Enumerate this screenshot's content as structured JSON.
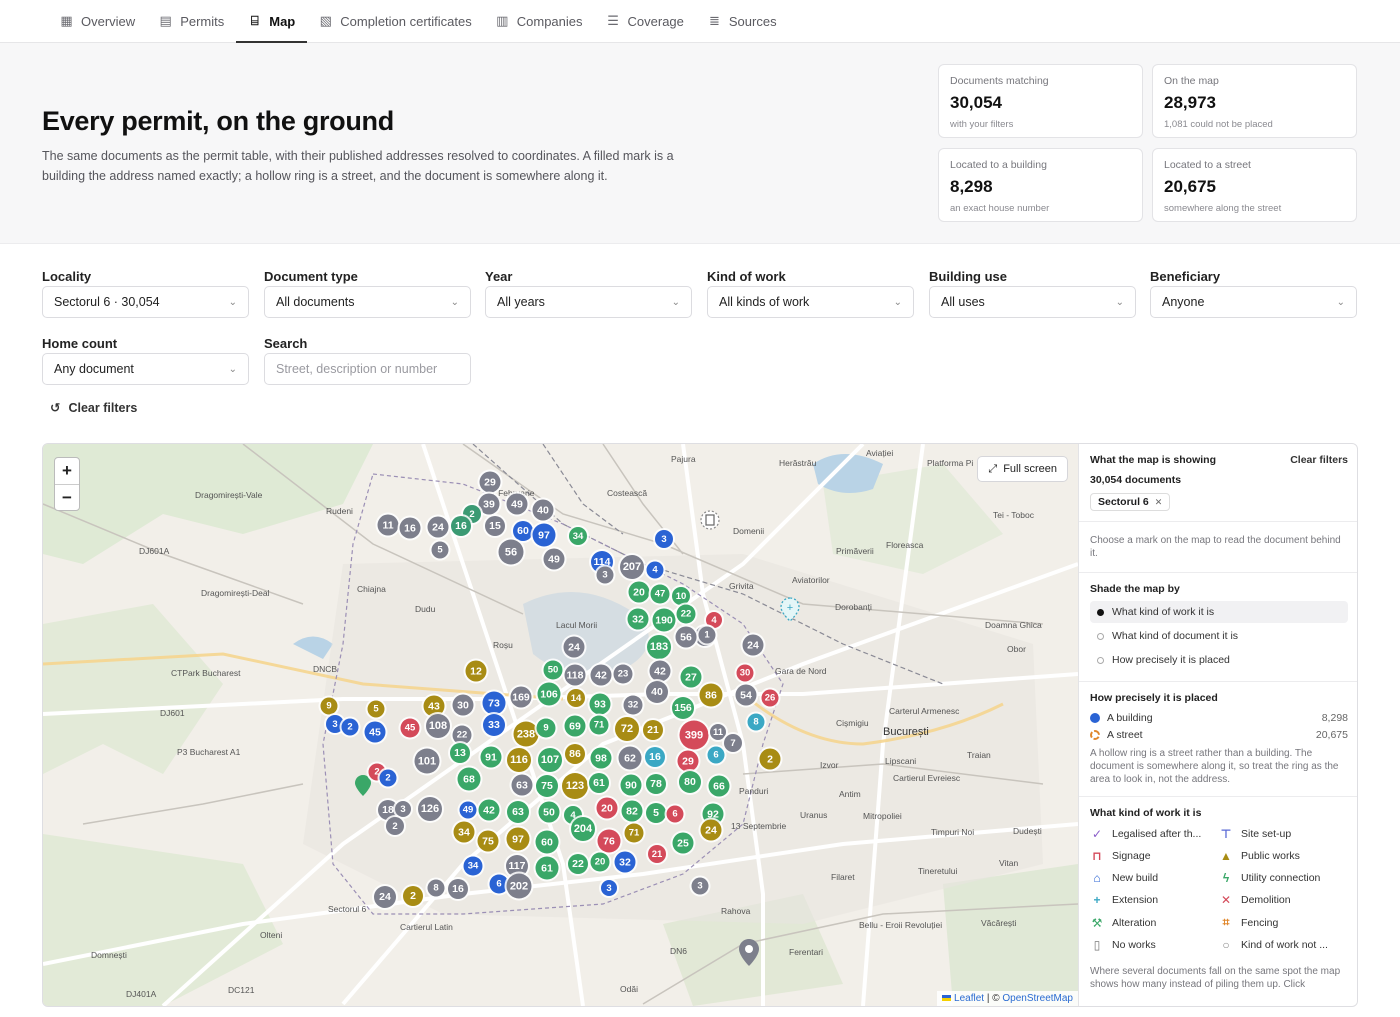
{
  "nav": [
    {
      "label": "Overview",
      "icon": "grid-icon",
      "glyph": "▦",
      "active": false
    },
    {
      "label": "Permits",
      "icon": "document-icon",
      "glyph": "▤",
      "active": false
    },
    {
      "label": "Map",
      "icon": "map-icon",
      "glyph": "⌸",
      "active": true
    },
    {
      "label": "Completion certificates",
      "icon": "certificate-icon",
      "glyph": "▧",
      "active": false
    },
    {
      "label": "Companies",
      "icon": "building-icon",
      "glyph": "▥",
      "active": false
    },
    {
      "label": "Coverage",
      "icon": "checklist-icon",
      "glyph": "☰",
      "active": false
    },
    {
      "label": "Sources",
      "icon": "database-icon",
      "glyph": "≣",
      "active": false
    }
  ],
  "hero": {
    "title": "Every permit, on the ground",
    "subtitle": "The same documents as the permit table, with their published addresses resolved to coordinates. A filled mark is a building the address named exactly; a hollow ring is a street, and the document is somewhere along it."
  },
  "stats": [
    {
      "label": "Documents matching",
      "value": "30,054",
      "note": "with your filters"
    },
    {
      "label": "On the map",
      "value": "28,973",
      "note": "1,081 could not be placed"
    },
    {
      "label": "Located to a building",
      "value": "8,298",
      "note": "an exact house number"
    },
    {
      "label": "Located to a street",
      "value": "20,675",
      "note": "somewhere along the street"
    }
  ],
  "filters": {
    "locality": {
      "label": "Locality",
      "value": "Sectorul 6 · 30,054"
    },
    "doc_type": {
      "label": "Document type",
      "value": "All documents"
    },
    "year": {
      "label": "Year",
      "value": "All years"
    },
    "kind": {
      "label": "Kind of work",
      "value": "All kinds of work"
    },
    "use": {
      "label": "Building use",
      "value": "All uses"
    },
    "beneficiary": {
      "label": "Beneficiary",
      "value": "Anyone"
    },
    "home_count": {
      "label": "Home count",
      "value": "Any document"
    },
    "search": {
      "label": "Search",
      "placeholder": "Street, description or number"
    },
    "clear": "Clear filters"
  },
  "map": {
    "zoom_in": "+",
    "zoom_out": "−",
    "fullscreen": "Full screen",
    "attribution_leaflet": "Leaflet",
    "attribution_sep": " | © ",
    "attribution_osm": "OpenStreetMap",
    "places": [
      {
        "name": "Pajura",
        "big": false
      },
      {
        "name": "Herăstrău",
        "big": false
      },
      {
        "name": "Aviației",
        "big": false
      },
      {
        "name": "Platforma Pi",
        "big": false
      },
      {
        "name": "Dragomirești-Vale",
        "big": false
      },
      {
        "name": "Rudeni",
        "big": false
      },
      {
        "name": "1 Februarie",
        "big": false
      },
      {
        "name": "Costească",
        "big": false
      },
      {
        "name": "Domenii",
        "big": false
      },
      {
        "name": "Tei - Toboc",
        "big": false
      },
      {
        "name": "Primăverii",
        "big": false
      },
      {
        "name": "Floreasca",
        "big": false
      },
      {
        "name": "Grivita",
        "big": false
      },
      {
        "name": "Aviatorilor",
        "big": false
      },
      {
        "name": "Dragomirești-Deal",
        "big": false
      },
      {
        "name": "Chiajna",
        "big": false
      },
      {
        "name": "Dudu",
        "big": false
      },
      {
        "name": "Dorobanți",
        "big": false
      },
      {
        "name": "Doamna Ghica",
        "big": false
      },
      {
        "name": "Roșu",
        "big": false
      },
      {
        "name": "Lacul Morii",
        "big": false
      },
      {
        "name": "Obor",
        "big": false
      },
      {
        "name": "Gara de Nord",
        "big": false
      },
      {
        "name": "Carterul Armenesc",
        "big": false
      },
      {
        "name": "Cișmigiu",
        "big": false
      },
      {
        "name": "București",
        "big": true
      },
      {
        "name": "Traian",
        "big": false
      },
      {
        "name": "Lipscani",
        "big": false
      },
      {
        "name": "Izvor",
        "big": false
      },
      {
        "name": "Cartierul Evreiesc",
        "big": false
      },
      {
        "name": "Antim",
        "big": false
      },
      {
        "name": "Panduri",
        "big": false
      },
      {
        "name": "Uranus",
        "big": false
      },
      {
        "name": "Mitropoliei",
        "big": false
      },
      {
        "name": "13 Septembrie",
        "big": false
      },
      {
        "name": "Timpuri Noi",
        "big": false
      },
      {
        "name": "Dudești",
        "big": false
      },
      {
        "name": "Vitan",
        "big": false
      },
      {
        "name": "Tineretului",
        "big": false
      },
      {
        "name": "Filaret",
        "big": false
      },
      {
        "name": "Rahova",
        "big": false
      },
      {
        "name": "Bellu - Eroii Revoluției",
        "big": false
      },
      {
        "name": "Văcărești",
        "big": false
      },
      {
        "name": "Ferentari",
        "big": false
      },
      {
        "name": "Cartierul Latin",
        "big": false
      },
      {
        "name": "Olteni",
        "big": false
      },
      {
        "name": "Domnești",
        "big": false
      },
      {
        "name": "Odăi",
        "big": false
      },
      {
        "name": "DJ601A",
        "big": false
      },
      {
        "name": "DJ601",
        "big": false
      },
      {
        "name": "DNCB",
        "big": false
      },
      {
        "name": "DN6",
        "big": false
      },
      {
        "name": "DC121",
        "big": false
      },
      {
        "name": "DJ401A",
        "big": false
      },
      {
        "name": "CTPark Bucharest",
        "big": false
      },
      {
        "name": "P3 Bucharest A1",
        "big": false
      },
      {
        "name": "Sectorul 6",
        "big": false
      }
    ],
    "clusters": [
      {
        "n": "29",
        "c": "#7d7f8c"
      },
      {
        "n": "39",
        "c": "#7d7f8c"
      },
      {
        "n": "49",
        "c": "#7d7f8c"
      },
      {
        "n": "40",
        "c": "#7d7f8c"
      },
      {
        "n": "2",
        "c": "#3b9a73"
      },
      {
        "n": "60",
        "c": "#2a63d4"
      },
      {
        "n": "97",
        "c": "#2a63d4"
      },
      {
        "n": "11",
        "c": "#7d7f8c"
      },
      {
        "n": "16",
        "c": "#7d7f8c"
      },
      {
        "n": "24",
        "c": "#7d7f8c"
      },
      {
        "n": "16",
        "c": "#3b9a73"
      },
      {
        "n": "15",
        "c": "#7d7f8c"
      },
      {
        "n": "5",
        "c": "#7d7f8c"
      },
      {
        "n": "56",
        "c": "#7d7f8c"
      },
      {
        "n": "49",
        "c": "#7d7f8c"
      },
      {
        "n": "34",
        "c": "#3aa768"
      },
      {
        "n": "3",
        "c": "#2a63d4"
      },
      {
        "n": "114",
        "c": "#2a63d4"
      },
      {
        "n": "207",
        "c": "#7d7f8c"
      },
      {
        "n": "3",
        "c": "#7d7f8c"
      },
      {
        "n": "4",
        "c": "#2a63d4"
      },
      {
        "n": "20",
        "c": "#3aa768"
      },
      {
        "n": "47",
        "c": "#3aa768"
      },
      {
        "n": "10",
        "c": "#3aa768"
      },
      {
        "n": "32",
        "c": "#3aa768"
      },
      {
        "n": "190",
        "c": "#3aa768"
      },
      {
        "n": "22",
        "c": "#3aa768"
      },
      {
        "n": "4",
        "c": "#d44a5a"
      },
      {
        "n": "24",
        "c": "#7d7f8c"
      },
      {
        "n": "183",
        "c": "#3aa768"
      },
      {
        "n": "56",
        "c": "#7d7f8c"
      },
      {
        "n": "1",
        "c": "#7d7f8c"
      },
      {
        "n": "24",
        "c": "#7d7f8c"
      },
      {
        "n": "24",
        "c": "#7d7f8c"
      },
      {
        "n": "50",
        "c": "#3aa768"
      },
      {
        "n": "118",
        "c": "#7d7f8c"
      },
      {
        "n": "42",
        "c": "#7d7f8c"
      },
      {
        "n": "23",
        "c": "#7d7f8c"
      },
      {
        "n": "42",
        "c": "#7d7f8c"
      },
      {
        "n": "12",
        "c": "#a88c14"
      },
      {
        "n": "27",
        "c": "#3aa768"
      },
      {
        "n": "30",
        "c": "#d44a5a"
      },
      {
        "n": "40",
        "c": "#7d7f8c"
      },
      {
        "n": "169",
        "c": "#7d7f8c"
      },
      {
        "n": "106",
        "c": "#3aa768"
      },
      {
        "n": "14",
        "c": "#a88c14"
      },
      {
        "n": "86",
        "c": "#a88c14"
      },
      {
        "n": "54",
        "c": "#7d7f8c"
      },
      {
        "n": "26",
        "c": "#d44a5a"
      },
      {
        "n": "9",
        "c": "#a88c14"
      },
      {
        "n": "5",
        "c": "#a88c14"
      },
      {
        "n": "43",
        "c": "#a88c14"
      },
      {
        "n": "30",
        "c": "#7d7f8c"
      },
      {
        "n": "73",
        "c": "#2a63d4"
      },
      {
        "n": "93",
        "c": "#3aa768"
      },
      {
        "n": "32",
        "c": "#7d7f8c"
      },
      {
        "n": "156",
        "c": "#3aa768"
      },
      {
        "n": "8",
        "c": "#3ba8c4"
      },
      {
        "n": "3",
        "c": "#2a63d4"
      },
      {
        "n": "2",
        "c": "#2a63d4"
      },
      {
        "n": "45",
        "c": "#2a63d4"
      },
      {
        "n": "45",
        "c": "#d44a5a"
      },
      {
        "n": "108",
        "c": "#7d7f8c"
      },
      {
        "n": "22",
        "c": "#7d7f8c"
      },
      {
        "n": "33",
        "c": "#2a63d4"
      },
      {
        "n": "238",
        "c": "#a88c14"
      },
      {
        "n": "9",
        "c": "#3aa768"
      },
      {
        "n": "69",
        "c": "#3aa768"
      },
      {
        "n": "71",
        "c": "#3aa768"
      },
      {
        "n": "72",
        "c": "#a88c14"
      },
      {
        "n": "21",
        "c": "#a88c14"
      },
      {
        "n": "399",
        "c": "#d44a5a"
      },
      {
        "n": "11",
        "c": "#7d7f8c"
      },
      {
        "n": "7",
        "c": "#7d7f8c"
      },
      {
        "n": "101",
        "c": "#7d7f8c"
      },
      {
        "n": "13",
        "c": "#3aa768"
      },
      {
        "n": "91",
        "c": "#3aa768"
      },
      {
        "n": "116",
        "c": "#a88c14"
      },
      {
        "n": "107",
        "c": "#3aa768"
      },
      {
        "n": "86",
        "c": "#a88c14"
      },
      {
        "n": "98",
        "c": "#3aa768"
      },
      {
        "n": "62",
        "c": "#7d7f8c"
      },
      {
        "n": "16",
        "c": "#3ba8c4"
      },
      {
        "n": "29",
        "c": "#d44a5a"
      },
      {
        "n": "6",
        "c": "#3ba8c4"
      },
      {
        "n": "2",
        "c": "#a88c14"
      },
      {
        "n": "2",
        "c": "#d44a5a"
      },
      {
        "n": "2",
        "c": "#2a63d4"
      },
      {
        "n": "68",
        "c": "#3aa768"
      },
      {
        "n": "63",
        "c": "#7d7f8c"
      },
      {
        "n": "75",
        "c": "#3aa768"
      },
      {
        "n": "123",
        "c": "#a88c14"
      },
      {
        "n": "61",
        "c": "#3aa768"
      },
      {
        "n": "90",
        "c": "#3aa768"
      },
      {
        "n": "78",
        "c": "#3aa768"
      },
      {
        "n": "80",
        "c": "#3aa768"
      },
      {
        "n": "66",
        "c": "#3aa768"
      },
      {
        "n": "18",
        "c": "#7d7f8c"
      },
      {
        "n": "3",
        "c": "#7d7f8c"
      },
      {
        "n": "126",
        "c": "#7d7f8c"
      },
      {
        "n": "2",
        "c": "#7d7f8c"
      },
      {
        "n": "49",
        "c": "#2a63d4"
      },
      {
        "n": "42",
        "c": "#3aa768"
      },
      {
        "n": "63",
        "c": "#3aa768"
      },
      {
        "n": "50",
        "c": "#3aa768"
      },
      {
        "n": "4",
        "c": "#3aa768"
      },
      {
        "n": "20",
        "c": "#d44a5a"
      },
      {
        "n": "82",
        "c": "#3aa768"
      },
      {
        "n": "5",
        "c": "#3aa768"
      },
      {
        "n": "6",
        "c": "#d44a5a"
      },
      {
        "n": "92",
        "c": "#3aa768"
      },
      {
        "n": "34",
        "c": "#a88c14"
      },
      {
        "n": "75",
        "c": "#a88c14"
      },
      {
        "n": "97",
        "c": "#a88c14"
      },
      {
        "n": "60",
        "c": "#3aa768"
      },
      {
        "n": "204",
        "c": "#3aa768"
      },
      {
        "n": "76",
        "c": "#d44a5a"
      },
      {
        "n": "71",
        "c": "#a88c14"
      },
      {
        "n": "24",
        "c": "#a88c14"
      },
      {
        "n": "25",
        "c": "#3aa768"
      },
      {
        "n": "34",
        "c": "#2a63d4"
      },
      {
        "n": "117",
        "c": "#7d7f8c"
      },
      {
        "n": "61",
        "c": "#3aa768"
      },
      {
        "n": "22",
        "c": "#3aa768"
      },
      {
        "n": "20",
        "c": "#3aa768"
      },
      {
        "n": "32",
        "c": "#2a63d4"
      },
      {
        "n": "21",
        "c": "#d44a5a"
      },
      {
        "n": "24",
        "c": "#7d7f8c"
      },
      {
        "n": "2",
        "c": "#a88c14"
      },
      {
        "n": "8",
        "c": "#7d7f8c"
      },
      {
        "n": "16",
        "c": "#7d7f8c"
      },
      {
        "n": "6",
        "c": "#2a63d4"
      },
      {
        "n": "202",
        "c": "#7d7f8c"
      },
      {
        "n": "3",
        "c": "#2a63d4"
      },
      {
        "n": "3",
        "c": "#7d7f8c"
      }
    ]
  },
  "panel": {
    "heading": "What the map is showing",
    "clear": "Clear filters",
    "count": "30,054 documents",
    "chip": "Sectorul 6",
    "chip_close": "✕",
    "hint": "Choose a mark on the map to read the document behind it.",
    "shade_heading": "Shade the map by",
    "shade_options": [
      {
        "label": "What kind of work it is",
        "selected": true
      },
      {
        "label": "What kind of document it is",
        "selected": false
      },
      {
        "label": "How precisely it is placed",
        "selected": false
      }
    ],
    "precision_heading": "How precisely it is placed",
    "precision": [
      {
        "label": "A building",
        "value": "8,298",
        "color": "#2a63d4",
        "hollow": false
      },
      {
        "label": "A street",
        "value": "20,675",
        "color": "#e0862a",
        "hollow": true
      }
    ],
    "precision_note": "A hollow ring is a street rather than a building. The document is somewhere along it, so treat the ring as the area to look in, not the address.",
    "kind_heading": "What kind of work it is",
    "kinds": [
      {
        "label": "Legalised after th...",
        "icon": "check-icon",
        "glyph": "✓",
        "color": "#8a5cc9"
      },
      {
        "label": "Site set-up",
        "icon": "crane-icon",
        "glyph": "⊤",
        "color": "#5a6ad6"
      },
      {
        "label": "Signage",
        "icon": "sign-icon",
        "glyph": "⊓",
        "color": "#d44a5a"
      },
      {
        "label": "Public works",
        "icon": "cone-icon",
        "glyph": "▲",
        "color": "#a88c14"
      },
      {
        "label": "New build",
        "icon": "house-icon",
        "glyph": "⌂",
        "color": "#2a63d4"
      },
      {
        "label": "Utility connection",
        "icon": "bolt-icon",
        "glyph": "ϟ",
        "color": "#3aa768"
      },
      {
        "label": "Extension",
        "icon": "plus-icon",
        "glyph": "+",
        "color": "#3ba8c4"
      },
      {
        "label": "Demolition",
        "icon": "x-icon",
        "glyph": "✕",
        "color": "#d44a5a"
      },
      {
        "label": "Alteration",
        "icon": "hammer-icon",
        "glyph": "⚒",
        "color": "#3aa768"
      },
      {
        "label": "Fencing",
        "icon": "fence-icon",
        "glyph": "⌗",
        "color": "#e0862a"
      },
      {
        "label": "No works",
        "icon": "page-icon",
        "glyph": "▯",
        "color": "#777"
      },
      {
        "label": "Kind of work not ...",
        "icon": "circle-icon",
        "glyph": "○",
        "color": "#888"
      }
    ],
    "footer": "Where several documents fall on the same spot the map shows how many instead of piling them up. Click"
  }
}
